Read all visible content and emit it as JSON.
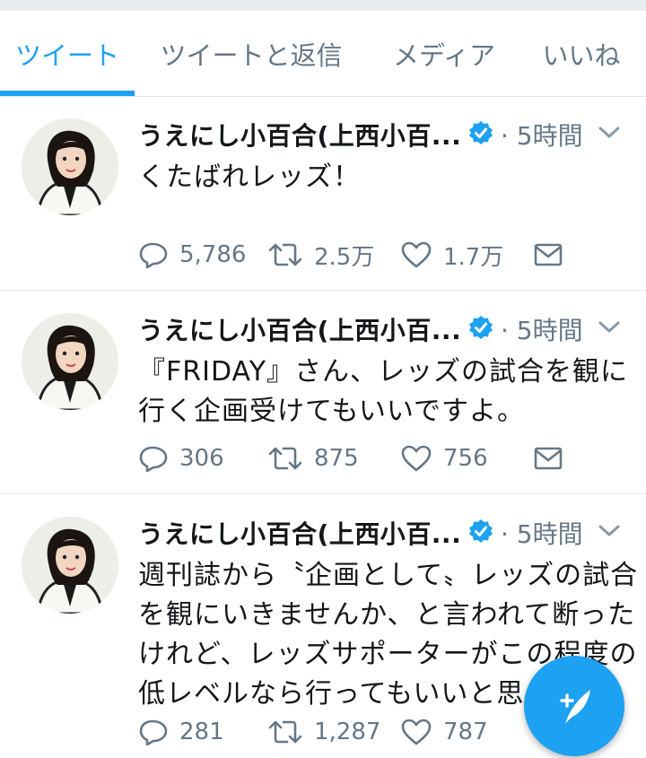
{
  "tabs": [
    {
      "label": "ツイート",
      "active": true
    },
    {
      "label": "ツイートと返信",
      "active": false
    },
    {
      "label": "メディア",
      "active": false
    },
    {
      "label": "いいね",
      "active": false
    }
  ],
  "tweets": [
    {
      "name": "うえにし小百合(上西小百...",
      "time": "· 5時間",
      "lines": [
        "くたばれレッズ！"
      ],
      "replies": "5,786",
      "retweets": "2.5万",
      "likes": "1.7万"
    },
    {
      "name": "うえにし小百合(上西小百...",
      "time": "· 5時間",
      "lines": [
        "『FRIDAY』さん、レッズの試合を観に",
        "行く企画受けてもいいですよ。"
      ],
      "replies": "306",
      "retweets": "875",
      "likes": "756"
    },
    {
      "name": "うえにし小百合(上西小百...",
      "time": "· 5時間",
      "lines": [
        "週刊誌から〝企画として〟レッズの試合",
        "を観にいきませんか、と言われて断った",
        "けれど、レッズサポーターがこの程度の",
        "低レベルなら行ってもいいと思う"
      ],
      "replies": "281",
      "retweets": "1,287",
      "likes": "787"
    }
  ],
  "colors": {
    "accent": "#1da1f2",
    "muted": "#657786",
    "text": "#14171a",
    "divider": "#e1e8ed"
  },
  "icons": {
    "verified": "verified-badge-icon",
    "reply": "reply-icon",
    "retweet": "retweet-icon",
    "like": "heart-icon",
    "dm": "envelope-icon",
    "compose": "compose-tweet-icon",
    "caret": "chevron-down-icon"
  }
}
